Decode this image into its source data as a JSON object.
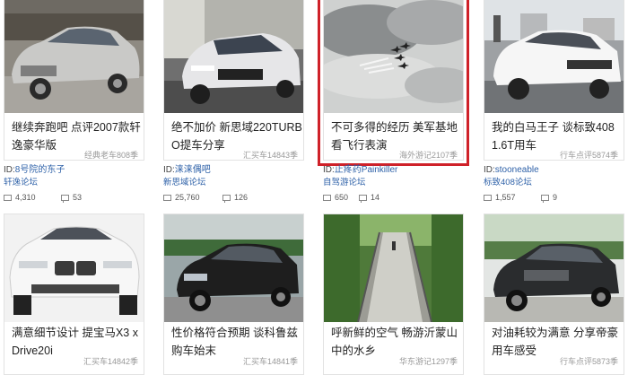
{
  "cards": [
    {
      "title": "继续奔跑吧 点评2007款轩逸豪华版",
      "forum_tag": "经典老车808季",
      "user_prefix": "ID:",
      "user": "8号院的东子",
      "forum": "轩逸论坛",
      "views": "4,310",
      "replies": "53"
    },
    {
      "title": "绝不加价 新思域220TURBO提车分享",
      "forum_tag": "汇买车14843季",
      "user_prefix": "ID:",
      "user": "涞涞偶吧",
      "forum": "新思域论坛",
      "views": "25,760",
      "replies": "126"
    },
    {
      "title": "不可多得的经历 美军基地看飞行表演",
      "forum_tag": "海外游记2107季",
      "user_prefix": "ID:",
      "user": "止疼药Painkiller",
      "forum": "自驾游论坛",
      "views": "650",
      "replies": "14"
    },
    {
      "title": "我的白马王子 谈标致408 1.6T用车",
      "forum_tag": "行车点评5874季",
      "user_prefix": "ID:",
      "user": "stooneable",
      "forum": "标致408论坛",
      "views": "1,557",
      "replies": "9"
    },
    {
      "title": "满意细节设计 提宝马X3 xDrive20i",
      "forum_tag": "汇买车14842季"
    },
    {
      "title": "性价格符合预期 谈科鲁兹购车始末",
      "forum_tag": "汇买车14841季"
    },
    {
      "title": "呼新鲜的空气 畅游沂蒙山中的水乡",
      "forum_tag": "华东游记1297季"
    },
    {
      "title": "对油耗较为满意 分享帝豪用车感受",
      "forum_tag": "行车点评5873季"
    }
  ],
  "colors": {
    "highlight": "#cf2129",
    "link": "#2e61a8"
  }
}
